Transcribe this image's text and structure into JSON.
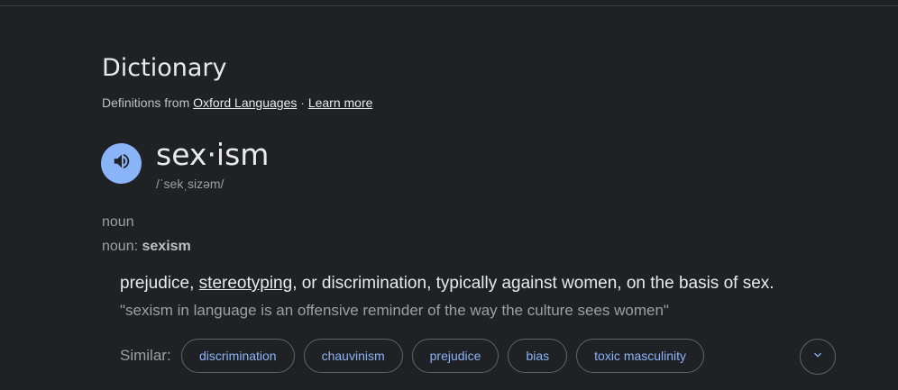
{
  "dictionary": {
    "title": "Dictionary",
    "source_prefix": "Definitions from",
    "source_link": "Oxford Languages",
    "separator": "·",
    "learn_more": "Learn more"
  },
  "entry": {
    "speaker_icon": "volume-icon",
    "headword": "sex·ism",
    "phonetic": "/ˈsekˌsizəm/",
    "part_of_speech": "noun",
    "pos_prefix": "noun",
    "pos_colon": ":",
    "pos_word": "sexism"
  },
  "definition": {
    "text_before": "prejudice,",
    "linked_word": "stereotyping",
    "text_after": ", or discrimination, typically against women, on the basis of sex.",
    "example": "\"sexism in language is an offensive reminder of the way the culture sees women\""
  },
  "similar": {
    "label": "Similar:",
    "chips": [
      "discrimination",
      "chauvinism",
      "prejudice",
      "bias",
      "toxic masculinity"
    ],
    "expand_icon": "chevron-down-icon"
  },
  "colors": {
    "background": "#202124",
    "accent_blue": "#8ab4f8",
    "text_primary": "#e8eaed",
    "text_secondary": "#9aa0a6"
  }
}
